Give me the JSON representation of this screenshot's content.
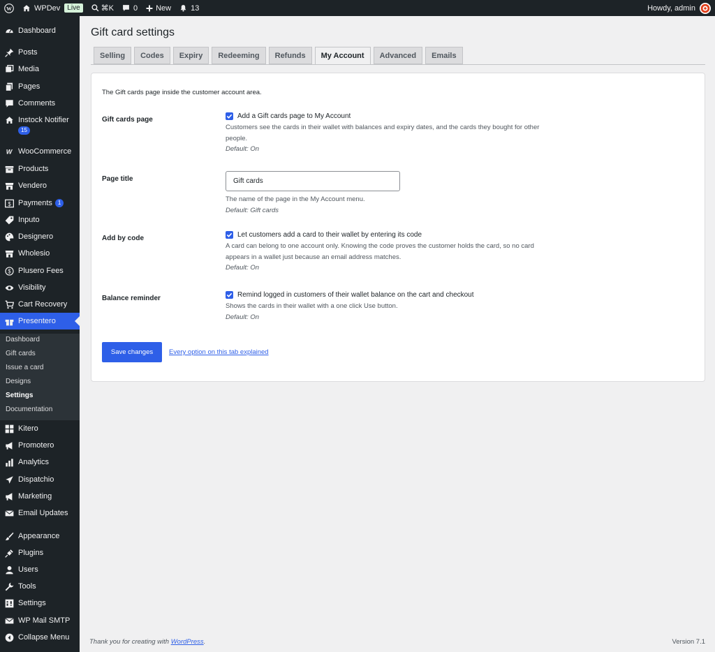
{
  "adminbar": {
    "site_name": "WPDev",
    "live_badge": "Live",
    "search_shortcut": "⌘K",
    "comments_count": "0",
    "new_label": "New",
    "notifications_count": "13",
    "howdy": "Howdy, admin"
  },
  "sidebar": {
    "items": [
      {
        "label": "Dashboard",
        "icon": "dashboard-icon"
      },
      {
        "label": "Posts",
        "icon": "pin-icon"
      },
      {
        "label": "Media",
        "icon": "media-icon"
      },
      {
        "label": "Pages",
        "icon": "pages-icon"
      },
      {
        "label": "Comments",
        "icon": "comment-icon"
      },
      {
        "label": "Instock Notifier",
        "icon": "home-icon",
        "badge": "15"
      },
      {
        "label": "WooCommerce",
        "icon": "woo-icon"
      },
      {
        "label": "Products",
        "icon": "archive-icon"
      },
      {
        "label": "Vendero",
        "icon": "store-icon"
      },
      {
        "label": "Payments",
        "icon": "dollar-icon",
        "badge": "1"
      },
      {
        "label": "Inputo",
        "icon": "tag-icon"
      },
      {
        "label": "Designero",
        "icon": "palette-icon"
      },
      {
        "label": "Wholesio",
        "icon": "store-icon"
      },
      {
        "label": "Plusero Fees",
        "icon": "coin-icon"
      },
      {
        "label": "Visibility",
        "icon": "eye-icon"
      },
      {
        "label": "Cart Recovery",
        "icon": "cart-icon"
      },
      {
        "label": "Presentero",
        "icon": "gift-icon"
      },
      {
        "label": "Kitero",
        "icon": "grid-icon"
      },
      {
        "label": "Promotero",
        "icon": "megaphone-icon"
      },
      {
        "label": "Analytics",
        "icon": "bar-chart-icon"
      },
      {
        "label": "Dispatchio",
        "icon": "plane-icon"
      },
      {
        "label": "Marketing",
        "icon": "megaphone-icon"
      },
      {
        "label": "Email Updates",
        "icon": "mail-icon"
      },
      {
        "label": "Appearance",
        "icon": "brush-icon"
      },
      {
        "label": "Plugins",
        "icon": "plug-icon"
      },
      {
        "label": "Users",
        "icon": "user-icon"
      },
      {
        "label": "Tools",
        "icon": "wrench-icon"
      },
      {
        "label": "Settings",
        "icon": "settings-icon"
      },
      {
        "label": "WP Mail SMTP",
        "icon": "mail-icon"
      },
      {
        "label": "Collapse Menu",
        "icon": "collapse-icon"
      }
    ],
    "submenu": [
      "Dashboard",
      "Gift cards",
      "Issue a card",
      "Designs",
      "Settings",
      "Documentation"
    ]
  },
  "page": {
    "title": "Gift card settings",
    "tabs": [
      "Selling",
      "Codes",
      "Expiry",
      "Redeeming",
      "Refunds",
      "My Account",
      "Advanced",
      "Emails"
    ],
    "active_tab": "My Account",
    "intro": "The Gift cards page inside the customer account area.",
    "rows": {
      "gift_cards_page": {
        "label": "Gift cards page",
        "checkbox_label": "Add a Gift cards page to My Account",
        "description": "Customers see the cards in their wallet with balances and expiry dates, and the cards they bought for other people.",
        "default": "Default: On"
      },
      "page_title": {
        "label": "Page title",
        "value": "Gift cards",
        "description": "The name of the page in the My Account menu.",
        "default": "Default: Gift cards"
      },
      "add_by_code": {
        "label": "Add by code",
        "checkbox_label": "Let customers add a card to their wallet by entering its code",
        "description": "A card can belong to one account only. Knowing the code proves the customer holds the card, so no card appears in a wallet just because an email address matches.",
        "default": "Default: On"
      },
      "balance_reminder": {
        "label": "Balance reminder",
        "checkbox_label": "Remind logged in customers of their wallet balance on the cart and checkout",
        "description": "Shows the cards in their wallet with a one click Use button.",
        "default": "Default: On"
      }
    },
    "save_label": "Save changes",
    "help_link": "Every option on this tab explained"
  },
  "footer": {
    "thanks_prefix": "Thank you for creating with ",
    "thanks_link": "WordPress",
    "thanks_suffix": ".",
    "version": "Version 7.1"
  },
  "colors": {
    "accent": "#2e5fe8",
    "admin_dark": "#1d2327",
    "background": "#f0f0f1"
  }
}
